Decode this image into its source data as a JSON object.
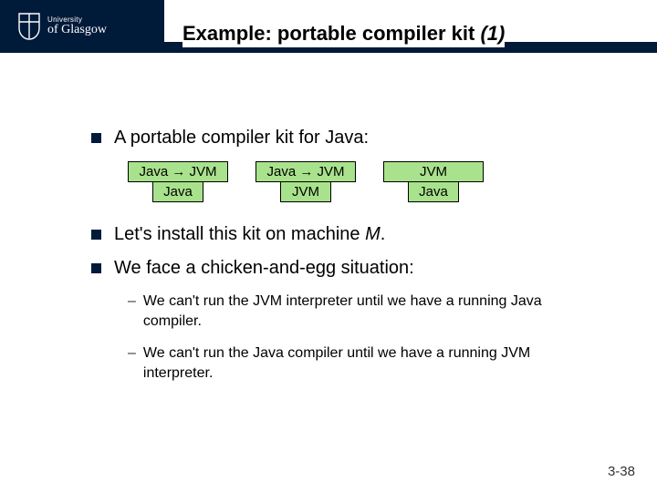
{
  "logo": {
    "line1": "University",
    "line2": "of Glasgow"
  },
  "title": {
    "main": "Example: portable compiler kit ",
    "italic": "(1)"
  },
  "bullets": {
    "b1": "A portable compiler kit for Java:",
    "b2_pre": "Let's install this kit on machine ",
    "b2_it": "M",
    "b2_post": ".",
    "b3": "We face a chicken-and-egg situation:"
  },
  "diagrams": {
    "d1": {
      "top": "Java → JVM",
      "stem": "Java"
    },
    "d2": {
      "top": "Java → JVM",
      "stem": "JVM"
    },
    "d3": {
      "top": "JVM",
      "stem": "Java"
    }
  },
  "subs": {
    "s1": "We can't run the JVM interpreter until we have a running Java compiler.",
    "s2": "We can't run the Java compiler until we have a running JVM interpreter."
  },
  "pagenum": "3-38"
}
